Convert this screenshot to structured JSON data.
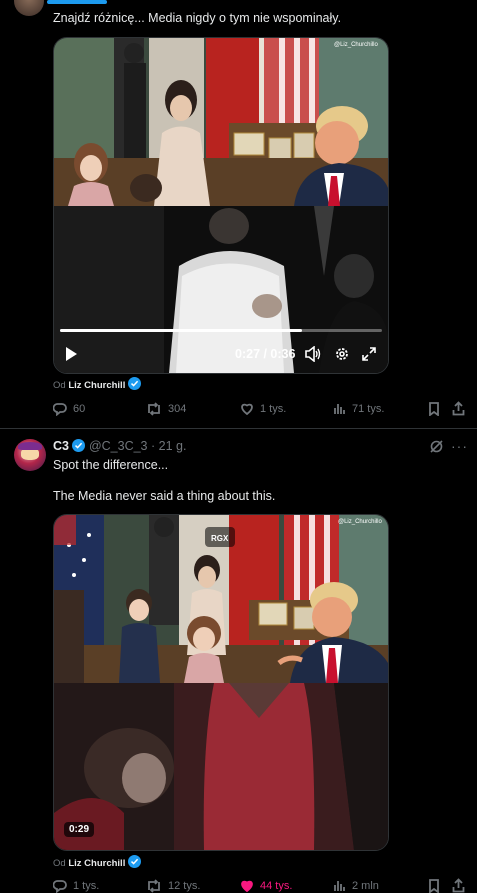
{
  "post1": {
    "text": "Znajdź różnicę... Media nigdy o tym nie wspominały.",
    "video": {
      "watermark": "@Liz_Churchillo",
      "time": "0:27 / 0:36",
      "progress": 0.75
    },
    "source_prefix": "Od",
    "source_name": "Liz Churchill",
    "actions": {
      "replies": "60",
      "reposts": "304",
      "likes": "1 tys.",
      "views": "71 tys."
    }
  },
  "post2": {
    "author_name": "C3",
    "handle": "@C_3C_3",
    "time": "· 21 g.",
    "text_line1": "Spot the difference...",
    "text_line2": "The Media never said a thing about this.",
    "video": {
      "watermark": "@Liz_Churchillo",
      "badge": "RGX",
      "duration": "0:29"
    },
    "source_prefix": "Od",
    "source_name": "Liz Churchill",
    "actions": {
      "replies": "1 tys.",
      "reposts": "12 tys.",
      "likes": "44 tys.",
      "views": "2 mln"
    }
  },
  "colors": {
    "accent": "#1d9bf0",
    "like_pink": "#f91880",
    "muted": "#71767b",
    "divider": "#2f3336"
  }
}
